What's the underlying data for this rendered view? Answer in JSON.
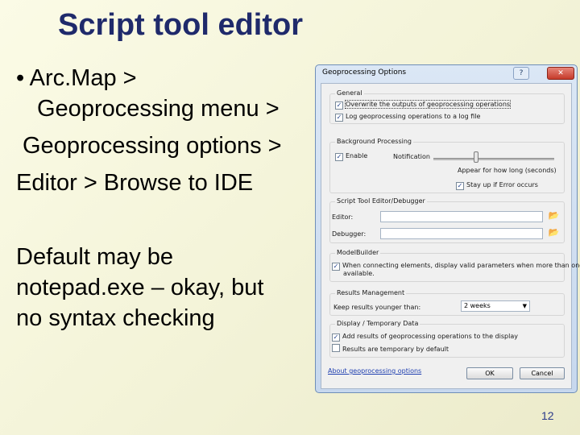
{
  "slide": {
    "title": "Script tool editor",
    "bullet_line1": "• Arc.Map >",
    "bullet_line2": "Geoprocessing menu >",
    "bullet_line3": "Geoprocessing options >",
    "bullet_line4": "Editor > Browse to IDE",
    "note_line1": "Default may be",
    "note_line2": "notepad.exe – okay, but",
    "note_line3": "no syntax checking",
    "page_number": "12"
  },
  "dialog": {
    "title": "Geoprocessing Options",
    "help_button": "?",
    "close_button": "✕",
    "general": {
      "label": "General",
      "overwrite": "Overwrite the outputs of geoprocessing operations",
      "overwrite_checked": true,
      "log": "Log geoprocessing operations to a log file",
      "log_checked": true
    },
    "background": {
      "label": "Background Processing",
      "enable": "Enable",
      "enable_checked": true,
      "notification": "Notification",
      "appear_for": "Appear for how long (seconds)",
      "stay_up": "Stay up if Error occurs",
      "stay_up_checked": true,
      "slider_level": 0.35
    },
    "script_tool": {
      "label": "Script Tool Editor/Debugger",
      "editor_label": "Editor:",
      "editor_value": "",
      "debugger_label": "Debugger:",
      "debugger_value": ""
    },
    "modelbuilder": {
      "label": "ModelBuilder",
      "connect_line1": "When connecting elements, display valid parameters when more than one is",
      "connect_line2": "available.",
      "connect_checked": true
    },
    "results": {
      "label": "Results Management",
      "keep_label": "Keep results younger than:",
      "keep_value": "2 weeks"
    },
    "display": {
      "label": "Display / Temporary Data",
      "add_results": "Add results of geoprocessing operations to the display",
      "add_results_checked": true,
      "temporary": "Results are temporary by default",
      "temporary_checked": false
    },
    "about_link": "About geoprocessing options",
    "ok": "OK",
    "cancel": "Cancel"
  }
}
